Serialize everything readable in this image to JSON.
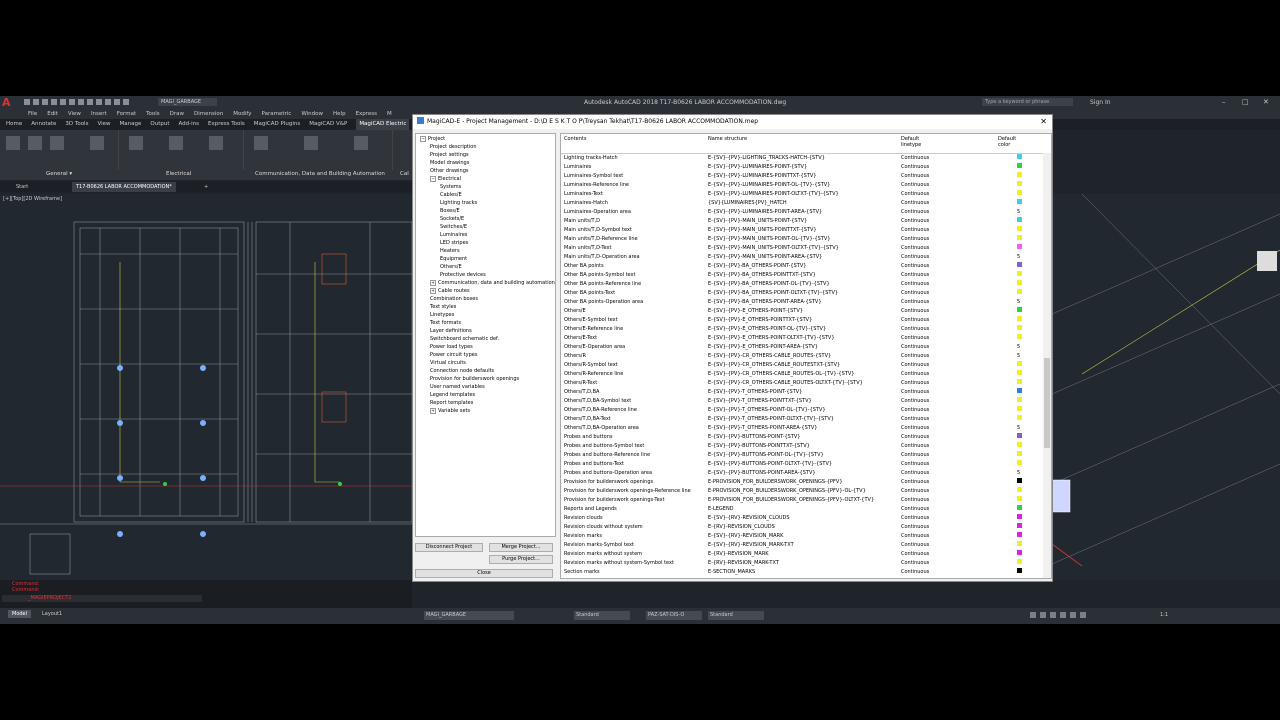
{
  "titlebar": {
    "logo": "A",
    "workspace": "MAGI_GARBAGE",
    "app_title": "Autodesk AutoCAD 2018   T17-B0626 LABOR ACCOMMODATION.dwg",
    "search_placeholder": "Type a keyword or phrase",
    "sign_in": "Sign In",
    "min": "–",
    "max": "□",
    "close": "✕"
  },
  "menu": [
    "File",
    "Edit",
    "View",
    "Insert",
    "Format",
    "Tools",
    "Draw",
    "Dimension",
    "Modify",
    "Parametric",
    "Window",
    "Help",
    "Express",
    "M"
  ],
  "ribbon_tabs": [
    "Home",
    "Annotate",
    "3D Tools",
    "View",
    "Manage",
    "Output",
    "Add-ins",
    "Express Tools",
    "MagiCAD Plugins",
    "MagiCAD V&P",
    "MagiCAD Electric"
  ],
  "ribbon_groups": {
    "general": "General ▾",
    "electrical": "Electrical",
    "communication": "Communication, Data and Building Automation",
    "cut": "Cal"
  },
  "file_tabs": {
    "start": "Start",
    "doc": "T17-B0626 LABOR ACCOMMODATION*",
    "add": "+"
  },
  "viewport_label": "[+][Top][2D Wireframe]",
  "command": {
    "line1": "Command:",
    "line2": "Command:",
    "input": "_MAGIEPROJECT2"
  },
  "status": {
    "model": "Model",
    "layout": "Layout1",
    "layer": "MAGI_GARBAGE",
    "style1": "Standard",
    "style2": "PAZ-SAT-DIS-O",
    "style3": "Standard",
    "scale": "1:1"
  },
  "dialog": {
    "title": "MagiCAD-E - Project Management - D:\\D E S K T O P\\Treysan Tekhat\\T17-B0626 LABOR ACCOMMODATION.mep",
    "close": "✕",
    "tree": [
      {
        "label": "Project",
        "level": 0,
        "expander": "−"
      },
      {
        "label": "Project description",
        "level": 1
      },
      {
        "label": "Project settings",
        "level": 1
      },
      {
        "label": "Model drawings",
        "level": 1
      },
      {
        "label": "Other drawings",
        "level": 1
      },
      {
        "label": "Electrical",
        "level": 1,
        "expander": "−"
      },
      {
        "label": "Systems",
        "level": 2
      },
      {
        "label": "Cables/E",
        "level": 2
      },
      {
        "label": "Lighting tracks",
        "level": 2
      },
      {
        "label": "Boxes/E",
        "level": 2
      },
      {
        "label": "Sockets/E",
        "level": 2
      },
      {
        "label": "Switches/E",
        "level": 2
      },
      {
        "label": "Luminaires",
        "level": 2
      },
      {
        "label": "LED stripes",
        "level": 2
      },
      {
        "label": "Heaters",
        "level": 2
      },
      {
        "label": "Equipment",
        "level": 2
      },
      {
        "label": "Others/E",
        "level": 2
      },
      {
        "label": "Protective devices",
        "level": 2
      },
      {
        "label": "Communication, data and building automation",
        "level": 1,
        "expander": "+"
      },
      {
        "label": "Cable routes",
        "level": 1,
        "expander": "+"
      },
      {
        "label": "Combination boxes",
        "level": 1
      },
      {
        "label": "Text styles",
        "level": 1
      },
      {
        "label": "Linetypes",
        "level": 1
      },
      {
        "label": "Text formats",
        "level": 1
      },
      {
        "label": "Layer definitions",
        "level": 1
      },
      {
        "label": "Switchboard schematic def.",
        "level": 1
      },
      {
        "label": "Power load types",
        "level": 1
      },
      {
        "label": "Power circuit types",
        "level": 1
      },
      {
        "label": "Virtual circuits",
        "level": 1
      },
      {
        "label": "Connection node defaults",
        "level": 1
      },
      {
        "label": "Provision for builderswork openings",
        "level": 1
      },
      {
        "label": "User named variables",
        "level": 1
      },
      {
        "label": "Legend templates",
        "level": 1
      },
      {
        "label": "Report templates",
        "level": 1
      },
      {
        "label": "Variable sets",
        "level": 1,
        "expander": "+"
      }
    ],
    "columns": {
      "contents": "Contents",
      "name": "Name structure",
      "linetype1": "Default",
      "linetype2": "linetype",
      "color1": "Default",
      "color2": "color"
    },
    "rows": [
      {
        "c": "Lighting tracks-Hatch",
        "n": "E-{SV}-{PV}-LIGHTING_TRACKS-HATCH-{STV}",
        "l": "Continuous",
        "color": "#3fd0e0"
      },
      {
        "c": "Luminaires",
        "n": "E-{SV}-{PV}-LUMINAIRES-POINT-{STV}",
        "l": "Continuous",
        "color": "#30d040"
      },
      {
        "c": "Luminaires-Symbol text",
        "n": "E-{SV}-{PV}-LUMINAIRES-POINTTXT-{STV}",
        "l": "Continuous",
        "color": "#f0f020"
      },
      {
        "c": "Luminaires-Reference line",
        "n": "E-{SV}-{PV}-LUMINAIRES-POINT-OL-{TV}-{STV}",
        "l": "Continuous",
        "color": "#f0f020"
      },
      {
        "c": "Luminaires-Text",
        "n": "E-{SV}-{PV}-LUMINAIRES-POINT-OLTXT-{TV}-{STV}",
        "l": "Continuous",
        "color": "#f0f020"
      },
      {
        "c": "Luminaires-Hatch",
        "n": "{SV}{LUMINAIRES{PV}_HATCH",
        "l": "Continuous",
        "color": "#3fd0e0"
      },
      {
        "c": "Luminaires-Operation area",
        "n": "E-{SV}-{PV}-LUMINAIRES-POINT-AREA-{STV}",
        "l": "Continuous",
        "num": "5"
      },
      {
        "c": "Main units/T,D",
        "n": "E-{SV}-{PV}-MAIN_UNITS-POINT-{STV}",
        "l": "Continuous",
        "color": "#3fd0e0"
      },
      {
        "c": "Main units/T,D-Symbol text",
        "n": "E-{SV}-{PV}-MAIN_UNITS-POINTTXT-{STV}",
        "l": "Continuous",
        "color": "#f0f020"
      },
      {
        "c": "Main units/T,D-Reference line",
        "n": "E-{SV}-{PV}-MAIN_UNITS-POINT-OL-{TV}-{STV}",
        "l": "Continuous",
        "color": "#f0f020"
      },
      {
        "c": "Main units/T,D-Text",
        "n": "E-{SV}-{PV}-MAIN_UNITS-POINT-OLTXT-{TV}-{STV}",
        "l": "Continuous",
        "color": "#f060f0"
      },
      {
        "c": "Main units/T,D-Operation area",
        "n": "E-{SV}-{PV}-MAIN_UNITS-POINT-AREA-{STV}",
        "l": "Continuous",
        "num": "5"
      },
      {
        "c": "Other BA points",
        "n": "E-{SV}-{PV}-BA_OTHERS-POINT-{STV}",
        "l": "Continuous",
        "color": "#8060d0"
      },
      {
        "c": "Other BA points-Symbol text",
        "n": "E-{SV}-{PV}-BA_OTHERS-POINTTXT-{STV}",
        "l": "Continuous",
        "color": "#f0f020"
      },
      {
        "c": "Other BA points-Reference line",
        "n": "E-{SV}-{PV}-BA_OTHERS-POINT-OL-{TV}-{STV}",
        "l": "Continuous",
        "color": "#f0f020"
      },
      {
        "c": "Other BA points-Text",
        "n": "E-{SV}-{PV}-BA_OTHERS-POINT-OLTXT-{TV}-{STV}",
        "l": "Continuous",
        "color": "#f0f020"
      },
      {
        "c": "Other BA points-Operation area",
        "n": "E-{SV}-{PV}-BA_OTHERS-POINT-AREA-{STV}",
        "l": "Continuous",
        "num": "5"
      },
      {
        "c": "Others/E",
        "n": "E-{SV}-{PV}-E_OTHERS-POINT-{STV}",
        "l": "Continuous",
        "color": "#30d040"
      },
      {
        "c": "Others/E-Symbol text",
        "n": "E-{SV}-{PV}-E_OTHERS-POINTTXT-{STV}",
        "l": "Continuous",
        "color": "#f0f020"
      },
      {
        "c": "Others/E-Reference line",
        "n": "E-{SV}-{PV}-E_OTHERS-POINT-OL-{TV}-{STV}",
        "l": "Continuous",
        "color": "#f0f020"
      },
      {
        "c": "Others/E-Text",
        "n": "E-{SV}-{PV}-E_OTHERS-POINT-OLTXT-{TV}-{STV}",
        "l": "Continuous",
        "color": "#f0f020"
      },
      {
        "c": "Others/E-Operation area",
        "n": "E-{SV}-{PV}-E_OTHERS-POINT-AREA-{STV}",
        "l": "Continuous",
        "num": "5"
      },
      {
        "c": "Others/R",
        "n": "E-{SV}-{PV}-CR_OTHERS-CABLE_ROUTES-{STV}",
        "l": "Continuous",
        "num": "5"
      },
      {
        "c": "Others/R-Symbol text",
        "n": "E-{SV}-{PV}-CR_OTHERS-CABLE_ROUTESTXT-{STV}",
        "l": "Continuous",
        "color": "#f0f020"
      },
      {
        "c": "Others/R-Reference line",
        "n": "E-{SV}-{PV}-CR_OTHERS-CABLE_ROUTES-OL-{TV}-{STV}",
        "l": "Continuous",
        "color": "#f0f020"
      },
      {
        "c": "Others/R-Text",
        "n": "E-{SV}-{PV}-CR_OTHERS-CABLE_ROUTES-OLTXT-{TV}-{STV}",
        "l": "Continuous",
        "color": "#f0f020"
      },
      {
        "c": "Others/T,D,BA",
        "n": "E-{SV}-{PV}-T_OTHERS-POINT-{STV}",
        "l": "Continuous",
        "color": "#3080e0"
      },
      {
        "c": "Others/T,D,BA-Symbol text",
        "n": "E-{SV}-{PV}-T_OTHERS-POINTTXT-{STV}",
        "l": "Continuous",
        "color": "#f0f020"
      },
      {
        "c": "Others/T,D,BA-Reference line",
        "n": "E-{SV}-{PV}-T_OTHERS-POINT-OL-{TV}-{STV}",
        "l": "Continuous",
        "color": "#f0f020"
      },
      {
        "c": "Others/T,D,BA-Text",
        "n": "E-{SV}-{PV}-T_OTHERS-POINT-OLTXT-{TV}-{STV}",
        "l": "Continuous",
        "color": "#f0f020"
      },
      {
        "c": "Others/T,D,BA-Operation area",
        "n": "E-{SV}-{PV}-T_OTHERS-POINT-AREA-{STV}",
        "l": "Continuous",
        "num": "5"
      },
      {
        "c": "Probes and buttons",
        "n": "E-{SV}-{PV}-BUTTONS-POINT-{STV}",
        "l": "Continuous",
        "color": "#8060d0"
      },
      {
        "c": "Probes and buttons-Symbol text",
        "n": "E-{SV}-{PV}-BUTTONS-POINTTXT-{STV}",
        "l": "Continuous",
        "color": "#f0f020"
      },
      {
        "c": "Probes and buttons-Reference line",
        "n": "E-{SV}-{PV}-BUTTONS-POINT-OL-{TV}-{STV}",
        "l": "Continuous",
        "color": "#f0f020"
      },
      {
        "c": "Probes and buttons-Text",
        "n": "E-{SV}-{PV}-BUTTONS-POINT-OLTXT-{TV}-{STV}",
        "l": "Continuous",
        "color": "#f0f020"
      },
      {
        "c": "Probes and buttons-Operation area",
        "n": "E-{SV}-{PV}-BUTTONS-POINT-AREA-{STV}",
        "l": "Continuous",
        "num": "5"
      },
      {
        "c": "Provision for builderswork openings",
        "n": "E-PROVISION_FOR_BUILDERSWORK_OPENINGS-{PFV}",
        "l": "Continuous",
        "color": "#000000"
      },
      {
        "c": "Provision for builderswork openings-Reference line",
        "n": "E-PROVISION_FOR_BUILDERSWORK_OPENINGS-{PFV}-OL-{TV}",
        "l": "Continuous",
        "color": "#f0f020"
      },
      {
        "c": "Provision for builderswork openings-Text",
        "n": "E-PROVISION_FOR_BUILDERSWORK_OPENINGS-{PFV}-OLTXT-{TV}",
        "l": "Continuous",
        "color": "#f0f020"
      },
      {
        "c": "Reports and Legends",
        "n": "E-LEGEND",
        "l": "Continuous",
        "color": "#30d040"
      },
      {
        "c": "Revision clouds",
        "n": "E-{SV}-{RV}-REVISION_CLOUDS",
        "l": "Continuous",
        "color": "#e020e0"
      },
      {
        "c": "Revision clouds without system",
        "n": "E-{RV}-REVISION_CLOUDS",
        "l": "Continuous",
        "color": "#e020e0"
      },
      {
        "c": "Revision marks",
        "n": "E-{SV}-{RV}-REVISION_MARK",
        "l": "Continuous",
        "color": "#e020e0"
      },
      {
        "c": "Revision marks-Symbol text",
        "n": "E-{SV}-{RV}-REVISION_MARK-TXT",
        "l": "Continuous",
        "color": "#f0f020"
      },
      {
        "c": "Revision marks without system",
        "n": "E-{RV}-REVISION_MARK",
        "l": "Continuous",
        "color": "#e020e0"
      },
      {
        "c": "Revision marks without system-Symbol text",
        "n": "E-{RV}-REVISION_MARK-TXT",
        "l": "Continuous",
        "color": "#f0f020"
      },
      {
        "c": "Section marks",
        "n": "E-SECTION_MARKS",
        "l": "Continuous",
        "color": "#000000"
      }
    ],
    "buttons": {
      "disconnect": "Disconnect Project",
      "merge": "Merge Project...",
      "purge": "Purge Project...",
      "close": "Close"
    }
  }
}
